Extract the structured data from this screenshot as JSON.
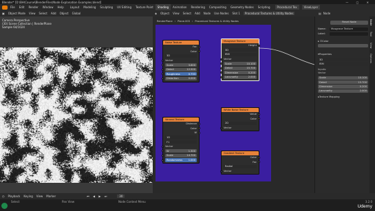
{
  "title": "Blender* [D:\\BH\\Course\\BlenderFiles\\Node Explanation Examples.blend]",
  "menu": [
    "File",
    "Edit",
    "Render",
    "Window",
    "Help"
  ],
  "workspaces": [
    "Layout",
    "Modeling",
    "Sculpting",
    "UV Editing",
    "Texture Paint",
    "Shading",
    "Animation",
    "Rendering",
    "Compositing",
    "Geometry Nodes",
    "Scripting"
  ],
  "active_workspace": "Shading",
  "scene_tab": "Procedural Tex",
  "view_layer": "ViewLayer",
  "view3d_header": {
    "mode": "Object Mode",
    "items": [
      "View",
      "Select",
      "Add",
      "Object"
    ],
    "shading": "Global"
  },
  "viewport_info": [
    "Camera Perspective",
    "(30) Scene Collection | RenderPlane",
    "Sample 64/1024"
  ],
  "node_header": {
    "editor": "Object",
    "items": [
      "View",
      "Select",
      "Add",
      "Node"
    ],
    "use_nodes": "Use Nodes",
    "slot": "Slot 1",
    "material": "Procedural Textures & Utility Nodes"
  },
  "breadcrumb": [
    "RenderPlane",
    "Plane.003",
    "Procedural Textures & Utility Nodes"
  ],
  "nodes": {
    "noise": {
      "title": "Noise Texture",
      "outputs": [
        "Fac",
        "Color"
      ],
      "dim": "3D",
      "vector": "Vector",
      "fields": [
        {
          "label": "Scale",
          "value": "3.600"
        },
        {
          "label": "Detail",
          "value": "12.500"
        },
        {
          "label": "Roughness",
          "value": "0.733"
        },
        {
          "label": "Distortion",
          "value": "0.000"
        }
      ]
    },
    "musgrave": {
      "title": "Musgrave Texture",
      "outputs": [
        "Height"
      ],
      "dim": "3D",
      "type": "fBM",
      "vector": "Vector",
      "fields": [
        {
          "label": "Scale",
          "value": "10.100"
        },
        {
          "label": "Detail",
          "value": "15.700"
        },
        {
          "label": "Dimension",
          "value": "0.200"
        },
        {
          "label": "Lacunarity",
          "value": "2.000"
        }
      ]
    },
    "voronoi": {
      "title": "Voronoi Texture",
      "outputs": [
        "Distance",
        "Color",
        "W"
      ],
      "dim": "1D",
      "feature": "F1",
      "vector": "Vector",
      "fields": [
        {
          "label": "W",
          "value": "1.300"
        },
        {
          "label": "Scale",
          "value": "14.700"
        },
        {
          "label": "Randomness",
          "value": "1.000"
        }
      ]
    },
    "white_noise": {
      "title": "White Noise Texture",
      "outputs": [
        "Value",
        "Color"
      ],
      "dim": "2D",
      "vector": "Vector"
    },
    "gradient": {
      "title": "Gradient Texture",
      "outputs": [
        "Color",
        "Fac"
      ],
      "type": "Radial",
      "vector": "Vector"
    }
  },
  "sidebar": {
    "tabs": [
      "Node",
      "Tool",
      "View",
      "Options"
    ],
    "node_label": "Node",
    "reset_label": "Reset Node",
    "name_label": "Name:",
    "name_value": "Musgrave Texture",
    "label_label": "Label:",
    "color_label": "Color",
    "properties_label": "Properties",
    "prop_dim": "3D",
    "prop_type": "fBM",
    "inputs_label": "Inputs:",
    "vector_label": "Vector",
    "fields": [
      {
        "label": "Scale",
        "value": "10.100"
      },
      {
        "label": "Detail",
        "value": "15.700"
      },
      {
        "label": "Dimension",
        "value": "0.200"
      },
      {
        "label": "Lacunarity",
        "value": "2.000"
      }
    ],
    "texture_mapping": "Texture Mapping"
  },
  "timeline": {
    "items": [
      "Playback",
      "Keying",
      "View",
      "Marker"
    ],
    "frame": "30"
  },
  "status": {
    "left": "Select",
    "mid": "Pan View",
    "right": "Node Context Menu",
    "version": "3.2.0"
  },
  "brand": "Udemy"
}
